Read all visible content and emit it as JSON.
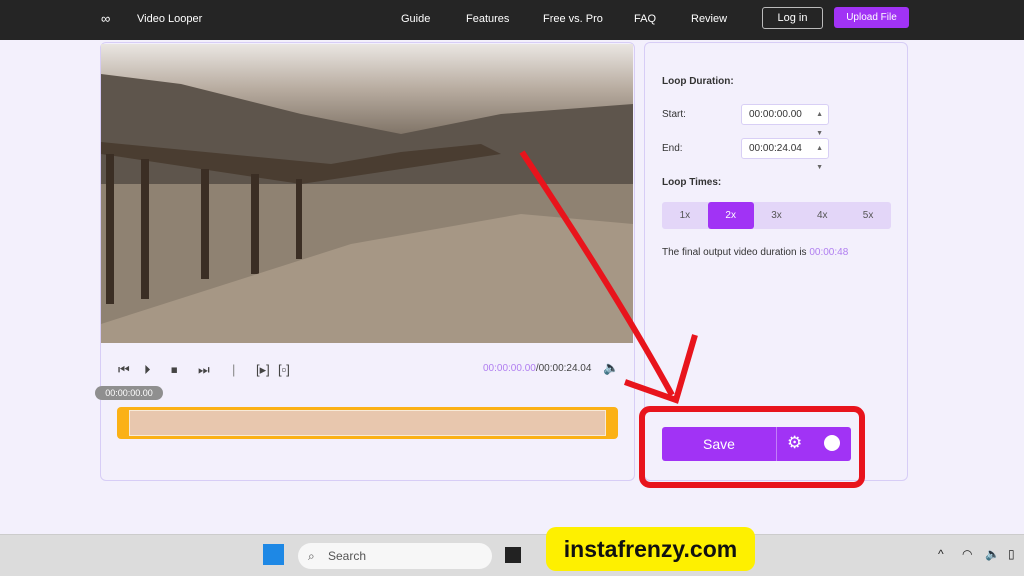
{
  "nav": {
    "brand": "Video Looper",
    "links": [
      "Guide",
      "Features",
      "Free vs. Pro",
      "FAQ",
      "Review"
    ],
    "login": "Log in",
    "upload": "Upload File"
  },
  "player": {
    "current_time": "00:00:00.00",
    "total_time": "/00:00:24.04",
    "playhead_label": "00:00:00.00"
  },
  "settings": {
    "loop_duration": "Loop Duration:",
    "start_label": "Start:",
    "start_value": "00:00:00.00",
    "end_label": "End:",
    "end_value": "00:00:24.04",
    "loop_times": "Loop Times:",
    "options": [
      "1x",
      "2x",
      "3x",
      "4x",
      "5x"
    ],
    "selected": "2x",
    "output_text": "The final output video duration is",
    "output_value": "00:00:48"
  },
  "save": {
    "label": "Save"
  },
  "taskbar": {
    "search": "Search"
  },
  "watermark": "instafrenzy.com",
  "colors": {
    "accent": "#a133f5",
    "annotation": "#e8141c",
    "timeline": "#fbb116"
  }
}
